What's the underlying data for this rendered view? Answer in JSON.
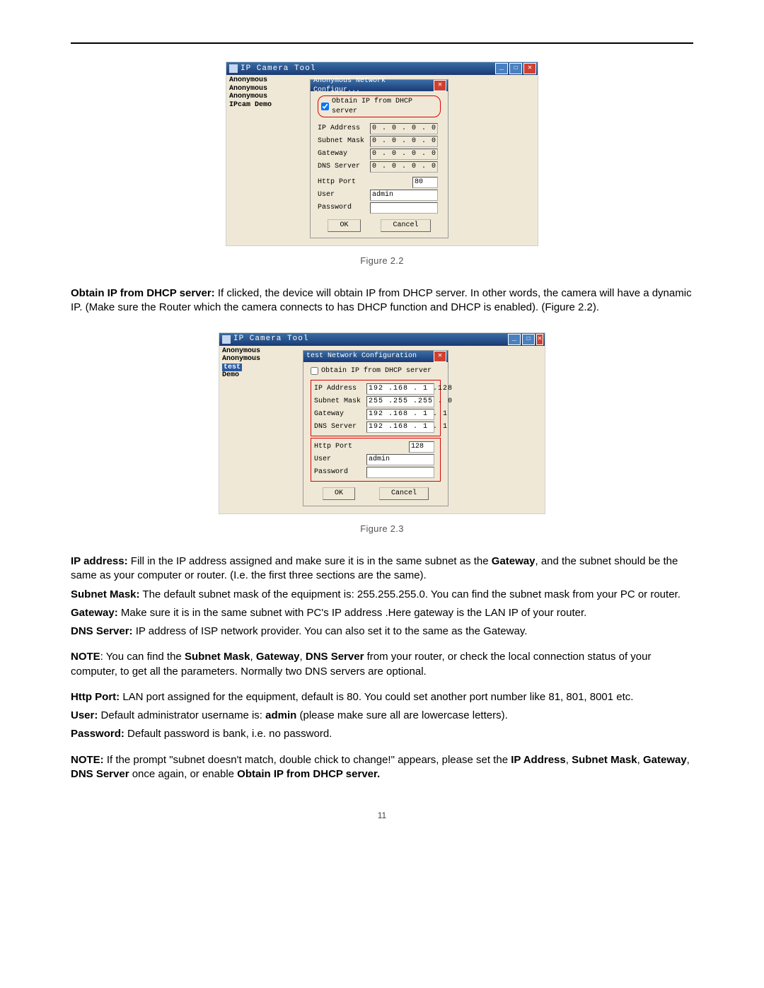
{
  "figure1": {
    "app_title": "IP Camera Tool",
    "device_list": [
      "Anonymous",
      "Anonymous",
      "Anonymous",
      "IPcam Demo"
    ],
    "dialog_title": "Anonymous Network Configur...",
    "dhcp_label": "Obtain IP from DHCP server",
    "dhcp_checked": true,
    "fields": {
      "ip_label": "IP Address",
      "ip_val": "0 . 0 . 0 . 0",
      "sm_label": "Subnet Mask",
      "sm_val": "0 . 0 . 0 . 0",
      "gw_label": "Gateway",
      "gw_val": "0 . 0 . 0 . 0",
      "dns_label": "DNS Server",
      "dns_val": "0 . 0 . 0 . 0",
      "port_label": "Http Port",
      "port_val": "80",
      "user_label": "User",
      "user_val": "admin",
      "pwd_label": "Password",
      "pwd_val": ""
    },
    "ok": "OK",
    "cancel": "Cancel",
    "caption": "Figure 2.2"
  },
  "para_dhcp": {
    "bold": "Obtain IP from DHCP server:",
    "text": " If clicked, the device will obtain IP from DHCP server. In other words, the camera will have a dynamic IP. (Make sure the Router which the camera connects to has DHCP function and DHCP is enabled). (Figure 2.2)."
  },
  "figure2": {
    "app_title": "IP Camera Tool",
    "device_list": [
      "Anonymous",
      "Anonymous",
      "test",
      "Demo"
    ],
    "selected_index": 2,
    "dialog_title": "test Network Configuration",
    "dhcp_label": "Obtain IP from DHCP server",
    "dhcp_checked": false,
    "fields": {
      "ip_label": "IP Address",
      "ip_val": "192 .168 . 1 .128",
      "sm_label": "Subnet Mask",
      "sm_val": "255 .255 .255 . 0",
      "gw_label": "Gateway",
      "gw_val": "192 .168 . 1 . 1",
      "dns_label": "DNS Server",
      "dns_val": "192 .168 . 1 . 1",
      "port_label": "Http Port",
      "port_val": "128",
      "user_label": "User",
      "user_val": "admin",
      "pwd_label": "Password",
      "pwd_val": ""
    },
    "ok": "OK",
    "cancel": "Cancel",
    "caption": "Figure 2.3"
  },
  "para_ip": {
    "bold1": "IP address:",
    "t1": " Fill in the IP address assigned and make sure it is in the same subnet as the ",
    "bold2": "Gateway",
    "t2": ", and the subnet should be the same as your computer or router. (I.e. the first three sections are the same)."
  },
  "para_subnet": {
    "bold": "Subnet Mask:",
    "text": " The default subnet mask of the equipment is: 255.255.255.0. You can find the subnet mask from your PC or router."
  },
  "para_gateway": {
    "bold": "Gateway:",
    "text": " Make sure it is in the same subnet with PC's IP address .Here gateway is the LAN IP of your router."
  },
  "para_dns": {
    "bold": "DNS Server:",
    "text": " IP address of ISP network provider. You can also set it to the same as the Gateway."
  },
  "note1": {
    "bold1": "NOTE",
    "t1": ": You can find the ",
    "bold2": "Subnet Mask",
    "bold3": "Gateway",
    "bold4": "DNS Server",
    "t2": " from your router, or check the local connection status of your computer, to get all the parameters. Normally two DNS servers are optional."
  },
  "para_port": {
    "bold": "Http Port:",
    "text": " LAN port assigned for the equipment, default is 80. You could set another port number like 81, 801, 8001 etc."
  },
  "para_user": {
    "bold1": "User:",
    "t1": " Default administrator username is: ",
    "bold2": "admin",
    "t2": " (please make sure all are lowercase letters)."
  },
  "para_password": {
    "bold": "Password:",
    "text": " Default password is bank, i.e. no password."
  },
  "note2": {
    "bold1": "NOTE:",
    "t1": " If the prompt \"subnet doesn't match, double chick to change!\" appears, please set the ",
    "bold2": "IP Address",
    "bold3": "Subnet Mask",
    "bold4": "Gateway",
    "bold5": "DNS Server",
    "t2": " once again, or enable ",
    "bold6": "Obtain IP from DHCP server."
  },
  "page_number": "11"
}
